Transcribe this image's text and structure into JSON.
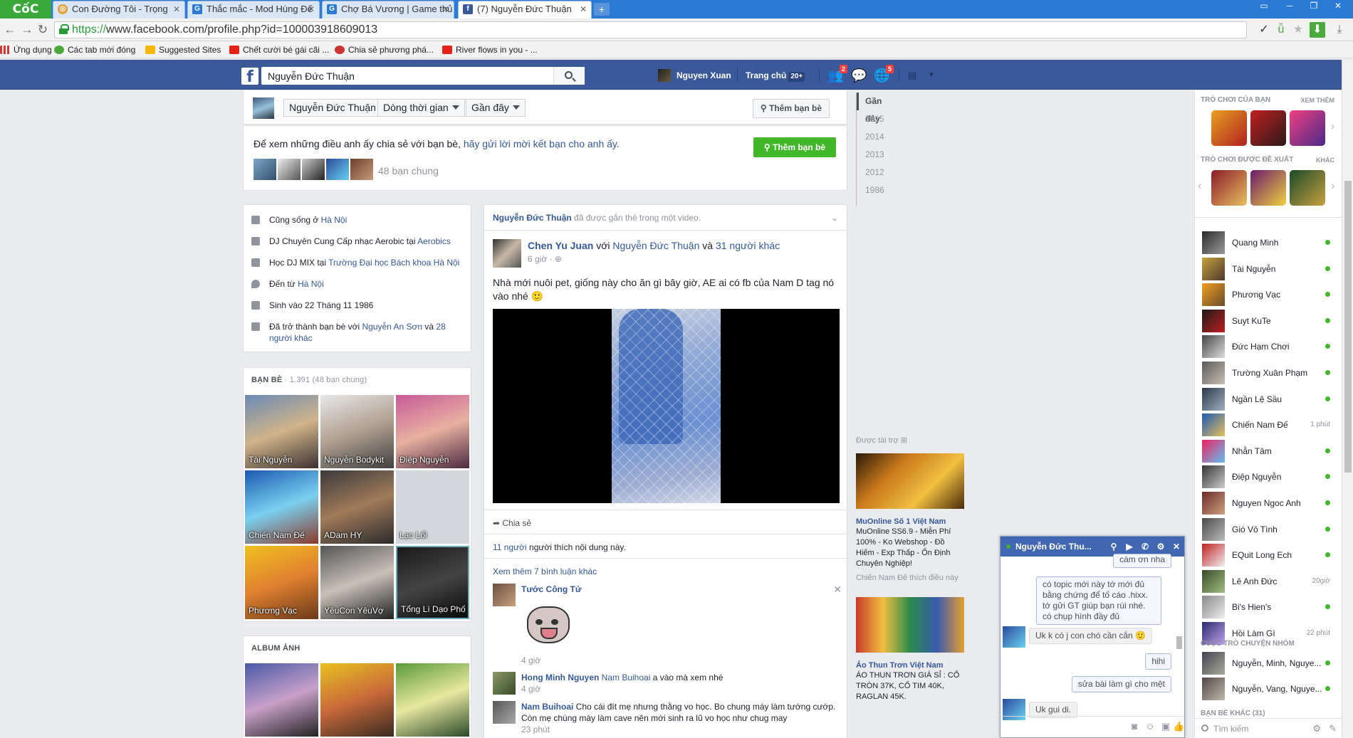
{
  "browser": {
    "logo": "CốC CốC",
    "tabs": [
      {
        "title": "Con Đường Tôi - Trọng",
        "active": false
      },
      {
        "title": "Thắc mắc - Mod Hùng Đế",
        "active": false
      },
      {
        "title": "Chợ Bá Vương | Game thủ",
        "active": false
      },
      {
        "title": "(7) Nguyễn Đức Thuận",
        "active": true
      }
    ],
    "url_scheme": "https://",
    "url_rest": "www.facebook.com/profile.php?id=100003918609013",
    "bookmarks": [
      "Ứng dụng",
      "Các tab mới đóng",
      "Suggested Sites",
      "Chết cười bé gái cãi ...",
      "Chia sẻ phương phá...",
      "River flows in you - ..."
    ]
  },
  "fb": {
    "search_value": "Nguyễn Đức Thuận",
    "user_name": "Nguyen Xuan",
    "home_label": "Trang chủ",
    "home_badge": "20+",
    "friend_requests_count": "2",
    "notifications_count": "5"
  },
  "profile": {
    "name_selector": "Nguyễn Đức Thuận",
    "timeline_selector": "Dòng thời gian",
    "recent_selector": "Gần đây",
    "add_friend": "Thêm bạn bè",
    "prompt_text": "Để xem những điều anh ấy chia sẻ với bạn bè, ",
    "prompt_link": "hãy gửi lời mời kết bạn cho anh ấy.",
    "add_friend_green": "Thêm bạn bè",
    "mutual_count": "48 bạn chung"
  },
  "scrubber": [
    "Gần đây",
    "2015",
    "2014",
    "2013",
    "2012",
    "1986"
  ],
  "intro": [
    {
      "pre": "Cũng sống ở ",
      "link": "Hà Nội",
      "post": ""
    },
    {
      "pre": "DJ Chuyên Cung Cấp nhạc Aerobic tại ",
      "link": "Aerobics",
      "post": ""
    },
    {
      "pre": "Học DJ MIX tại ",
      "link": "Trường Đại học Bách khoa Hà Nội",
      "post": ""
    },
    {
      "pre": "Đến từ ",
      "link": "Hà Nội",
      "post": ""
    },
    {
      "pre": "Sinh vào 22 Tháng 11 1986",
      "link": "",
      "post": ""
    },
    {
      "pre": "Đã trở thành bạn bè với ",
      "link": "Nguyễn An Sơn",
      "post": " và ",
      "link2": "28 người khác"
    }
  ],
  "friends": {
    "title": "BẠN BÈ",
    "subtitle": " · 1.391 (48 bạn chung)",
    "items": [
      "Tài Nguyễn",
      "Nguyễn Bodykit",
      "Điệp Nguyễn",
      "Chiến Nam Đế",
      "ADam HY",
      "Lạc Lối",
      "Phương Vạc",
      "YêuCon YêuVợ",
      "Tổng Lì Dạo Phố"
    ]
  },
  "albums": {
    "title": "ALBUM ẢNH"
  },
  "post": {
    "tag_name": "Nguyễn Đức Thuận",
    "tag_rest": " đã được gắn thẻ trong một video.",
    "author": "Chen Yu Juan",
    "with_text": " với ",
    "with_name": "Nguyễn Đức Thuận",
    "and_text": " và ",
    "others": "31 người khác",
    "time": "6 giờ · ",
    "text": "Nhà mới nuôi pet, giống này cho ăn gì bây giờ, AE ai có fb của Nam D tag nó vào nhé 🙂",
    "share": "Chia sẻ",
    "likes_link": "11 người",
    "likes_rest": " người thích nội dung này.",
    "more_comments": "Xem thêm 7 bình luận khác",
    "comments": [
      {
        "name": "Tước Công Tử",
        "text": "",
        "time": "4 giờ"
      },
      {
        "name": "Hong Minh Nguyen",
        "mention": "Nam Buihoai",
        "text": " a vào mà xem nhé",
        "time": "4 giờ"
      },
      {
        "name": "Nam Buihoai",
        "text": " Cho cái đít mẹ nhưng thằng vo học. Bo chung máy làm tướng cướp. Còn mẹ chúng mày làm cave nên mới sinh ra lũ vo học như chug may",
        "time": "23 phút"
      }
    ]
  },
  "ads": {
    "head": "Được tài trợ",
    "items": [
      {
        "title": "MuOnline Số 1 Việt Nam",
        "text": "MuOnline SS6.9 - Miễn Phí 100% - Ko Webshop - Đồ Hiếm - Exp Thấp - Ổn Định Chuyên Nghiệp!",
        "like": "Chiến Nam Đế thích điều này"
      },
      {
        "title": "Áo Thun Trơn Việt Nam",
        "text": "ÁO THUN TRƠN GIÁ SỈ : CỔ TRÒN 37K, CỔ TIM 40K, RAGLAN 45K.",
        "like": ""
      }
    ]
  },
  "sidebar": {
    "games_head": "TRÒ CHƠI CỦA BẠN",
    "see_more": "XEM THÊM",
    "suggested_head": "TRÒ CHƠI ĐƯỢC ĐỀ XUẤT",
    "other": "KHÁC",
    "contacts": [
      {
        "name": "Quang Minh",
        "status": "online",
        "time": ""
      },
      {
        "name": "Tài Nguyễn",
        "status": "online",
        "time": ""
      },
      {
        "name": "Phương Vạc",
        "status": "online",
        "time": ""
      },
      {
        "name": "Suyt KuTe",
        "status": "online",
        "time": ""
      },
      {
        "name": "Đức Hạm Chơi",
        "status": "online",
        "time": ""
      },
      {
        "name": "Trường Xuân Phạm",
        "status": "online",
        "time": ""
      },
      {
        "name": "Ngần Lệ Sầu",
        "status": "online",
        "time": ""
      },
      {
        "name": "Chiến Nam Đế",
        "status": "time",
        "time": "1 phút"
      },
      {
        "name": "Nhẫn Tâm",
        "status": "online",
        "time": ""
      },
      {
        "name": "Điệp Nguyễn",
        "status": "online",
        "time": ""
      },
      {
        "name": "Nguyen Ngoc Anh",
        "status": "online",
        "time": ""
      },
      {
        "name": "Gió Vô Tình",
        "status": "online",
        "time": ""
      },
      {
        "name": "EQuit Long Ech",
        "status": "online",
        "time": ""
      },
      {
        "name": "Lê Anh Đức",
        "status": "time",
        "time": "20giờ"
      },
      {
        "name": "Bi's Hien's",
        "status": "online",
        "time": ""
      },
      {
        "name": "Hồi Làm Gì",
        "status": "time",
        "time": "22 phút"
      }
    ],
    "group_head": "CUỘC TRÒ CHUYỆN NHÓM",
    "groups": [
      "Nguyễn, Minh, Nguye...",
      "Nguyễn, Vang, Nguye..."
    ],
    "other_friends": "BẠN BÈ KHÁC (31)",
    "search_placeholder": "Tìm kiếm"
  },
  "chat": {
    "title": "Nguyễn Đức Thu...",
    "messages": [
      {
        "dir": "out",
        "text": "cám ơn nha"
      },
      {
        "dir": "out",
        "text": "có topic mới này tớ mới đủ bằng chứng để tố cáo .hixx. tớ gửi GT giúp bạn rùi nhé. có chụp hình đầy đủ"
      },
      {
        "dir": "in",
        "text": "Uk k có j con chó cần cắn 🙂"
      },
      {
        "dir": "out",
        "text": "hihi"
      },
      {
        "dir": "out",
        "text": "sửa bài làm gì cho mệt"
      },
      {
        "dir": "in",
        "text": "Uk gui di."
      }
    ]
  }
}
